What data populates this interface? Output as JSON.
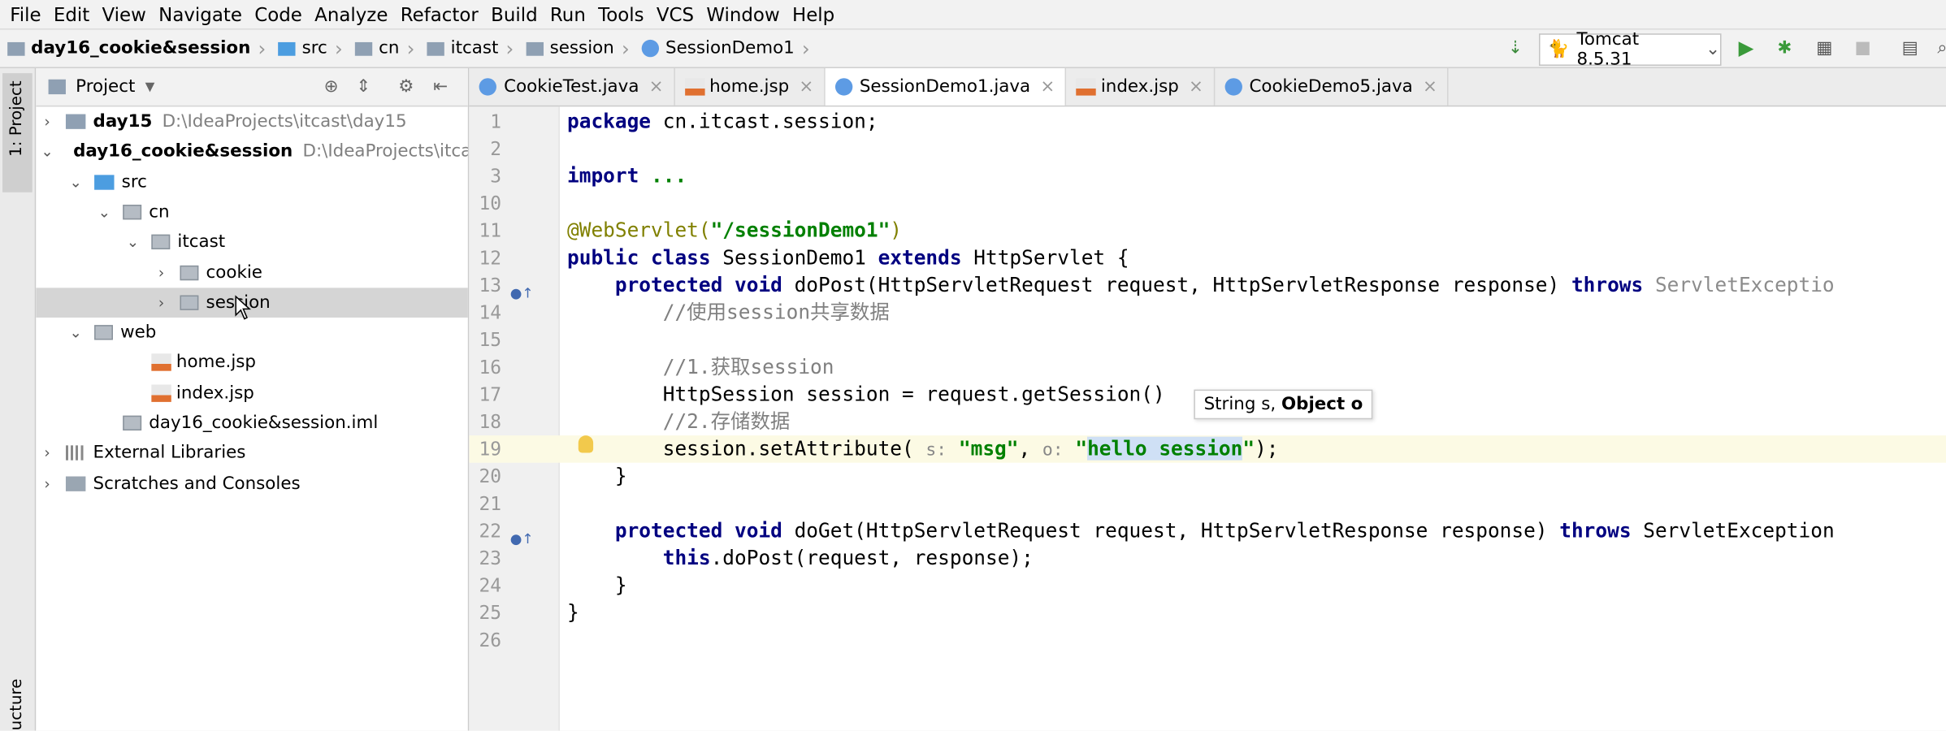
{
  "menu": [
    "File",
    "Edit",
    "View",
    "Navigate",
    "Code",
    "Analyze",
    "Refactor",
    "Build",
    "Run",
    "Tools",
    "VCS",
    "Window",
    "Help"
  ],
  "breadcrumb": [
    "day16_cookie&session",
    "src",
    "cn",
    "itcast",
    "session",
    "SessionDemo1"
  ],
  "run_config": "Tomcat 8.5.31",
  "side_tabs": {
    "project": "1: Project",
    "structure": "ucture"
  },
  "project_panel": {
    "title": "Project",
    "tree": [
      {
        "label": "day15",
        "path": "D:\\IdeaProjects\\itcast\\day15",
        "level": 0,
        "arrow": "›",
        "bold": true,
        "icon": "module-folder"
      },
      {
        "label": "day16_cookie&session",
        "path": "D:\\IdeaProjects\\itcas",
        "level": 0,
        "arrow": "⌄",
        "bold": true,
        "icon": "module-folder"
      },
      {
        "label": "src",
        "path": "",
        "level": 1,
        "arrow": "⌄",
        "bold": false,
        "icon": "source-folder"
      },
      {
        "label": "cn",
        "path": "",
        "level": 2,
        "arrow": "⌄",
        "bold": false,
        "icon": "package"
      },
      {
        "label": "itcast",
        "path": "",
        "level": 3,
        "arrow": "⌄",
        "bold": false,
        "icon": "package"
      },
      {
        "label": "cookie",
        "path": "",
        "level": 4,
        "arrow": "›",
        "bold": false,
        "icon": "package"
      },
      {
        "label": "session",
        "path": "",
        "level": 4,
        "arrow": "›",
        "bold": false,
        "icon": "package"
      },
      {
        "label": "web",
        "path": "",
        "level": 1,
        "arrow": "⌄",
        "bold": false,
        "icon": "web-folder"
      },
      {
        "label": "home.jsp",
        "path": "",
        "level": 3,
        "arrow": "",
        "bold": false,
        "icon": "jsp-file"
      },
      {
        "label": "index.jsp",
        "path": "",
        "level": 3,
        "arrow": "",
        "bold": false,
        "icon": "jsp-file"
      },
      {
        "label": "day16_cookie&session.iml",
        "path": "",
        "level": 2,
        "arrow": "",
        "bold": false,
        "icon": "iml-file"
      },
      {
        "label": "External Libraries",
        "path": "",
        "level": 0,
        "arrow": "›",
        "bold": false,
        "icon": "libraries"
      },
      {
        "label": "Scratches and Consoles",
        "path": "",
        "level": 0,
        "arrow": "›",
        "bold": false,
        "icon": "scratches"
      }
    ]
  },
  "tabs": [
    {
      "label": "CookieTest.java",
      "icon": "class"
    },
    {
      "label": "home.jsp",
      "icon": "jsp"
    },
    {
      "label": "SessionDemo1.java",
      "icon": "class",
      "active": true
    },
    {
      "label": "index.jsp",
      "icon": "jsp"
    },
    {
      "label": "CookieDemo5.java",
      "icon": "class"
    }
  ],
  "editor": {
    "line_numbers": [
      "1",
      "2",
      "3",
      "10",
      "11",
      "12",
      "13",
      "14",
      "15",
      "16",
      "17",
      "18",
      "19",
      "20",
      "21",
      "22",
      "23",
      "24",
      "25",
      "26"
    ],
    "lines": {
      "l1a": "package",
      "l1b": " cn.itcast.session;",
      "l3a": "import",
      "l3b": " ...",
      "l11a": "@WebServlet(",
      "l11b": "\"/sessionDemo1\"",
      "l11c": ")",
      "l12a": "public class",
      "l12b": " SessionDemo1 ",
      "l12c": "extends",
      "l12d": " HttpServlet {",
      "l13a": "    protected void",
      "l13b": " doPost(HttpServletRequest request, HttpServletResponse response) ",
      "l13c": "throws",
      "l13d": " ServletExceptio",
      "l14": "        //使用session共享数据",
      "l16": "        //1.获取session",
      "l17": "        HttpSession session = request.getSession()",
      "l18": "        //2.存储数据",
      "l19a": "        session.setAttribute( ",
      "l19b": "s:",
      "l19c": " \"msg\"",
      ", ": "",
      "l19d": ", ",
      "l19e": "o:",
      "l19f": " \"",
      "l19g": "hello session",
      "l19h": "\"",
      "l19i": ");",
      "l20": "    }",
      "l22a": "    protected void",
      "l22b": " doGet(HttpServletRequest request, HttpServletResponse response) ",
      "l22c": "throws",
      "l22d": " ServletException",
      "l23a": "        this",
      "l23b": ".doPost(request, response);",
      "l24": "    }",
      "l25": "}"
    },
    "tooltip": {
      "normal": "String s, ",
      "bold": "Object o"
    }
  }
}
